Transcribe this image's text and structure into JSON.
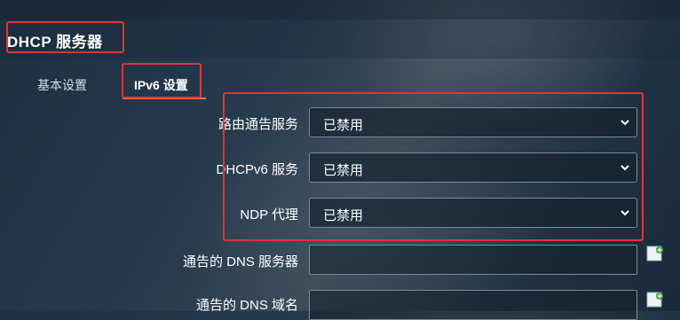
{
  "page": {
    "title": "DHCP 服务器"
  },
  "tabs": [
    {
      "label": "基本设置",
      "active": false
    },
    {
      "label": "IPv6 设置",
      "active": true
    }
  ],
  "fields": {
    "router_advert": {
      "label": "路由通告服务",
      "value": "已禁用"
    },
    "dhcpv6": {
      "label": "DHCPv6 服务",
      "value": "已禁用"
    },
    "ndp_proxy": {
      "label": "NDP 代理",
      "value": "已禁用"
    },
    "dns_servers": {
      "label": "通告的 DNS 服务器",
      "value": ""
    },
    "dns_domain": {
      "label": "通告的 DNS 域名",
      "value": ""
    }
  },
  "colors": {
    "highlight": "#e63232",
    "tab_accent": "#f07a2a"
  },
  "icons": {
    "select_arrow": "chevron-down-icon",
    "add": "add-item-icon"
  }
}
